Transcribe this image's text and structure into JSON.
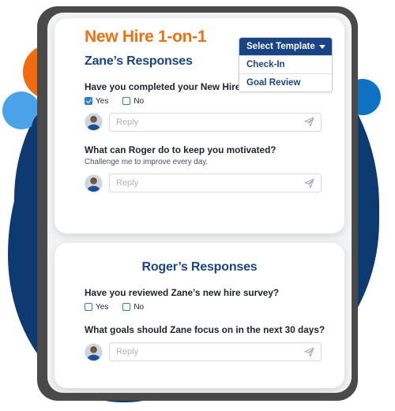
{
  "header": {
    "title": "New Hire 1-on-1"
  },
  "template_dropdown": {
    "selected_label": "Select Template",
    "options": [
      {
        "label": "Check-In"
      },
      {
        "label": "Goal Review"
      }
    ]
  },
  "sections": [
    {
      "heading": "Zane’s Responses",
      "align": "left",
      "questions": [
        {
          "text": "Have you completed your New Hire survey?",
          "answer": null,
          "choices": [
            {
              "label": "Yes",
              "checked": true
            },
            {
              "label": "No",
              "checked": false
            }
          ],
          "reply_placeholder": "Reply",
          "reply_value": ""
        },
        {
          "text": "What can Roger do to keep you motivated?",
          "answer": "Challenge me to improve every day.",
          "choices": [],
          "reply_placeholder": "Reply",
          "reply_value": ""
        }
      ]
    },
    {
      "heading": "Roger’s Responses",
      "align": "center",
      "questions": [
        {
          "text": "Have you reviewed Zane’s new hire survey?",
          "answer": null,
          "choices": [
            {
              "label": "Yes",
              "checked": false
            },
            {
              "label": "No",
              "checked": false
            }
          ],
          "reply_placeholder": null,
          "reply_value": ""
        },
        {
          "text": "What goals should Zane focus on in the next 30 days?",
          "answer": null,
          "choices": [],
          "reply_placeholder": "Reply",
          "reply_value": ""
        }
      ]
    }
  ],
  "colors": {
    "title_orange": "#ED7014",
    "navy": "#1B4484",
    "checkbox_blue": "#2F7FD4",
    "blob_navy": "#0E3A72",
    "deco_orange": "#F26B0F",
    "deco_light_blue": "#4AA3E8",
    "deco_blue": "#0D72C4",
    "device_gray": "#4A4A4A"
  },
  "icons": {
    "dropdown_caret": "chevron-down-icon",
    "send": "send-paper-plane-icon",
    "avatar": "user-avatar-photo"
  }
}
